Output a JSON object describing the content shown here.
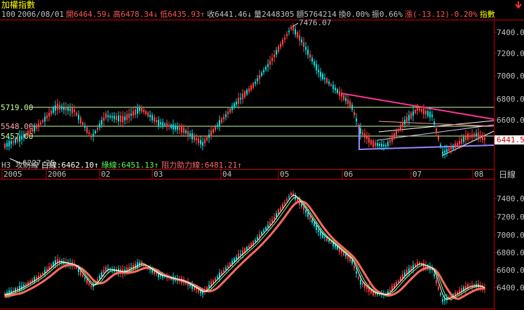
{
  "window": {
    "title": "加權指數",
    "period_label": "日線"
  },
  "info_bar": {
    "prefix": "100",
    "date": "2006/08/01",
    "open": "開6464.59↓",
    "high": "高6478.34↓",
    "low": "低6435.93↑",
    "close": "收6441.46↓",
    "volume": "量2448305",
    "amount": "額5764214",
    "turnover": "換0.00%",
    "amplitude": "振0.66%",
    "change": "漲(-13.12)-0.20%",
    "tail": "指數"
  },
  "upper_chart": {
    "price_labels": [
      "7400.00",
      "7200.00",
      "7000.00",
      "6800.00",
      "6600.00",
      "6400.00"
    ],
    "level_labels": [
      "5719.00",
      "5548.00",
      "5457.00"
    ],
    "high_label": "7476.07",
    "low_label": "6227.25",
    "current_label": "6441.5",
    "time_labels": [
      "2005",
      "2006",
      "02",
      "03",
      "04",
      "05",
      "06",
      "07",
      "08"
    ]
  },
  "lower_chart": {
    "legend_name": "H3 攻防線",
    "white_line": "白線:6462.10↑",
    "green_line": "綠線:6451.13↑",
    "red_line": "阻力助力線:6481.21↑",
    "price_labels": [
      "7400.00",
      "7200.00",
      "7000.00",
      "6800.00",
      "6600.00",
      "6400.00"
    ]
  },
  "colors": {
    "up": "#ff4444",
    "down": "#00e0e0",
    "axis": "#cc0000",
    "info_red": "#ff5555",
    "info_green": "#55ff55",
    "info_yellow": "#ffff00",
    "resistance_line": "#ff3399",
    "support_line": "#9988ff",
    "level_line": "#ccff99"
  },
  "icons": {
    "menu": "down-arrow-menu-icon"
  }
}
